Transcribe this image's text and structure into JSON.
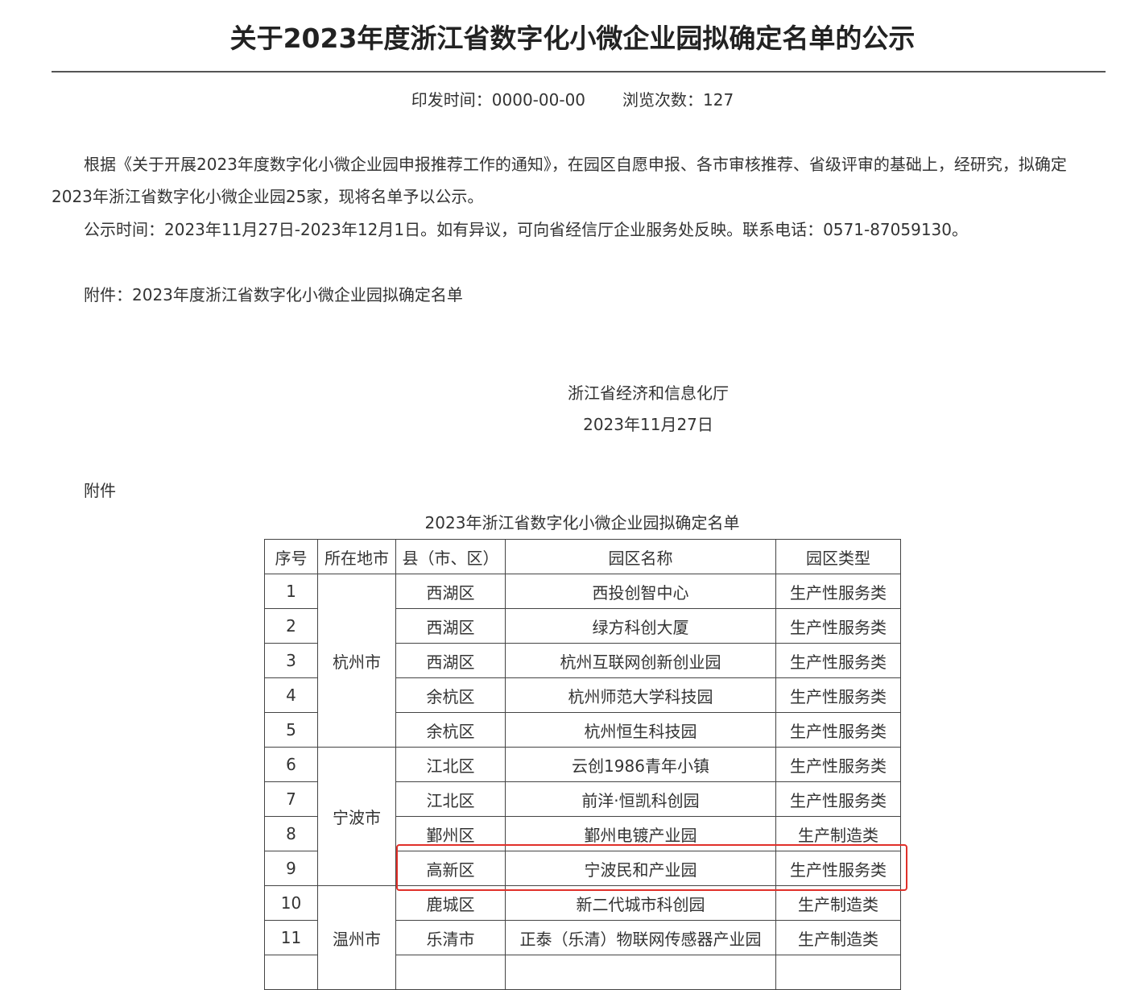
{
  "title": "关于2023年度浙江省数字化小微企业园拟确定名单的公示",
  "meta": {
    "issue_date_label": "印发时间：",
    "issue_date": "0000-00-00",
    "views_label": "浏览次数：",
    "views": "127"
  },
  "body": {
    "paragraph1": "根据《关于开展2023年度数字化小微企业园申报推荐工作的通知》，在园区自愿申报、各市审核推荐、省级评审的基础上，经研究，拟确定2023年浙江省数字化小微企业园25家，现将名单予以公示。",
    "paragraph2": "公示时间：2023年11月27日-2023年12月1日。如有异议，可向省经信厅企业服务处反映。联系电话：0571-87059130。",
    "attachment_line": "附件：2023年度浙江省数字化小微企业园拟确定名单"
  },
  "signature": {
    "org": "浙江省经济和信息化厅",
    "date": "2023年11月27日"
  },
  "attachment": {
    "label": "附件",
    "table_title": "2023年浙江省数字化小微企业园拟确定名单",
    "headers": [
      "序号",
      "所在地市",
      "县（市、区）",
      "园区名称",
      "园区类型"
    ],
    "rows": [
      {
        "no": "1",
        "city": "杭州市",
        "county": "西湖区",
        "park": "西投创智中心",
        "type": "生产性服务类"
      },
      {
        "no": "2",
        "county": "西湖区",
        "park": "绿方科创大厦",
        "type": "生产性服务类"
      },
      {
        "no": "3",
        "county": "西湖区",
        "park": "杭州互联网创新创业园",
        "type": "生产性服务类"
      },
      {
        "no": "4",
        "county": "余杭区",
        "park": "杭州师范大学科技园",
        "type": "生产性服务类"
      },
      {
        "no": "5",
        "county": "余杭区",
        "park": "杭州恒生科技园",
        "type": "生产性服务类"
      },
      {
        "no": "6",
        "city": "宁波市",
        "county": "江北区",
        "park": "云创1986青年小镇",
        "type": "生产性服务类"
      },
      {
        "no": "7",
        "county": "江北区",
        "park": "前洋·恒凯科创园",
        "type": "生产性服务类"
      },
      {
        "no": "8",
        "county": "鄞州区",
        "park": "鄞州电镀产业园",
        "type": "生产制造类"
      },
      {
        "no": "9",
        "county": "高新区",
        "park": "宁波民和产业园",
        "type": "生产性服务类"
      },
      {
        "no": "10",
        "city": "温州市",
        "county": "鹿城区",
        "park": "新二代城市科创园",
        "type": "生产制造类"
      },
      {
        "no": "11",
        "county": "乐清市",
        "park": "正泰（乐清）物联网传感器产业园",
        "type": "生产制造类"
      }
    ]
  },
  "highlight_color": "#e0302a"
}
